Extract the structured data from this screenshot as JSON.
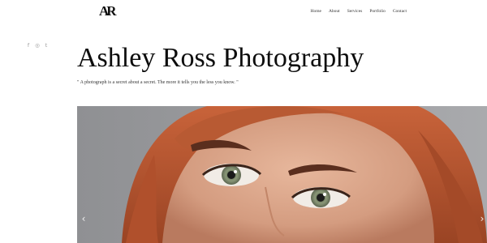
{
  "header": {
    "logo_text": "AR",
    "nav": [
      "Home",
      "About",
      "Services",
      "Portfolio",
      "Contact"
    ]
  },
  "social": {
    "icons": [
      "facebook-icon",
      "instagram-icon",
      "tumblr-icon"
    ],
    "glyphs": [
      "f",
      "◎",
      "t"
    ]
  },
  "hero": {
    "title": "Ashley Ross Photography",
    "quote": "\" A photograph is a secret about a secret. The more it tells you the less you know. \""
  },
  "slider": {
    "prev_glyph": "‹",
    "next_glyph": "›"
  },
  "colors": {
    "background": "#ffffff",
    "text": "#111111",
    "hair": "#b5532a",
    "skin": "#dfa98e",
    "eye_iris": "#7d8a6e",
    "photo_backdrop": "#a2a3a6"
  }
}
